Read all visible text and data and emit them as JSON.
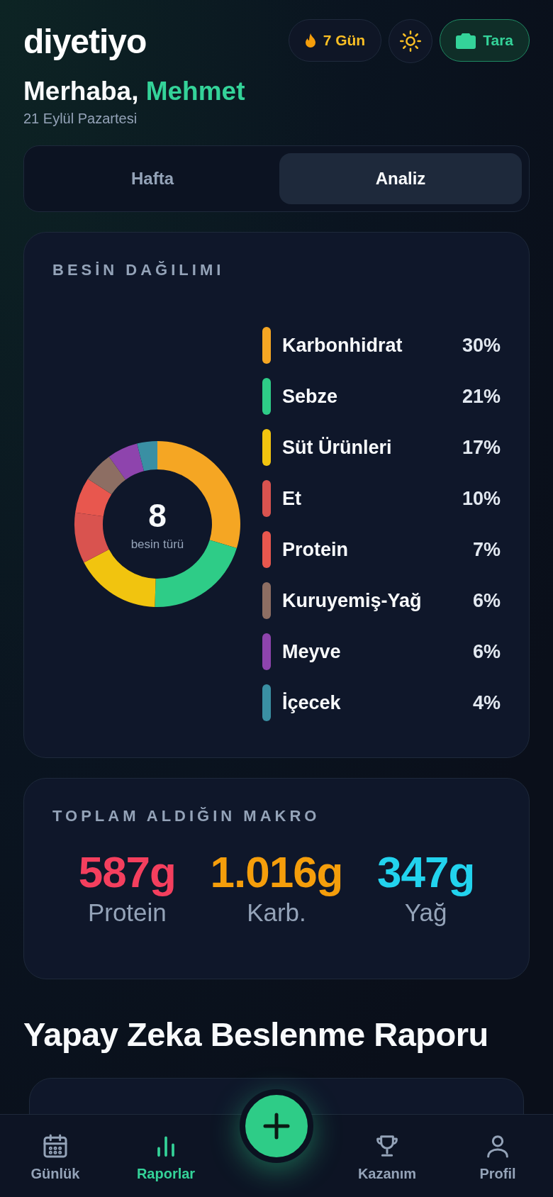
{
  "header": {
    "logo": "diyetiyo",
    "streak": "7 Gün",
    "scan_button": "Tara"
  },
  "greeting": {
    "hello": "Merhaba,",
    "name": "Mehmet",
    "date": "21 Eylül Pazartesi"
  },
  "tabs": [
    {
      "label": "Hafta",
      "selected": false
    },
    {
      "label": "Analiz",
      "selected": true
    }
  ],
  "distribution": {
    "title": "BESİN DAĞILIMI",
    "center_value": "8",
    "center_label": "besin türü",
    "items": [
      {
        "value": "30%",
        "color": "#f5a623"
      },
      {
        "value": "21%",
        "color": "#2ecc87"
      },
      {
        "value": "17%",
        "color": "#f1c40f"
      },
      {
        "value": "10%",
        "color": "#d9534f"
      },
      {
        "value": "7%",
        "color": "#e8574e"
      },
      {
        "value": "6%",
        "color": "#8d6e63"
      },
      {
        "value": "6%",
        "color": "#8e44ad"
      },
      {
        "value": "4%",
        "color": "#3a8fa3"
      }
    ],
    "chart_data": {
      "type": "donut",
      "categories": [
        "Karbonhidrat",
        "Sebze",
        "Süt Ürünleri",
        "Et",
        "Protein",
        "Kuruyemiş-Yağ",
        "Meyve",
        "İçecek"
      ],
      "values": [
        30,
        21,
        17,
        10,
        7,
        6,
        6,
        4
      ]
    }
  },
  "macros": {
    "title": "TOPLAM ALDIĞIN MAKRO",
    "items": [
      {
        "value": "587g",
        "label": "Protein",
        "color": "#f43f5e"
      },
      {
        "value": "1.016g",
        "label": "Karb.",
        "color": "#f59e0b"
      },
      {
        "value": "347g",
        "label": "Yağ",
        "color": "#22d3ee"
      }
    ]
  },
  "report": {
    "title": "Yapay Zeka Beslenme Raporu"
  },
  "nav": [
    {
      "kind": "calendar",
      "label": "Günlük",
      "selected": false
    },
    {
      "kind": "chart",
      "label": "Raporlar",
      "selected": true
    },
    {
      "kind": "add"
    },
    {
      "kind": "trophy",
      "label": "Kazanım",
      "selected": false
    },
    {
      "kind": "user",
      "label": "Profil",
      "selected": false
    }
  ]
}
